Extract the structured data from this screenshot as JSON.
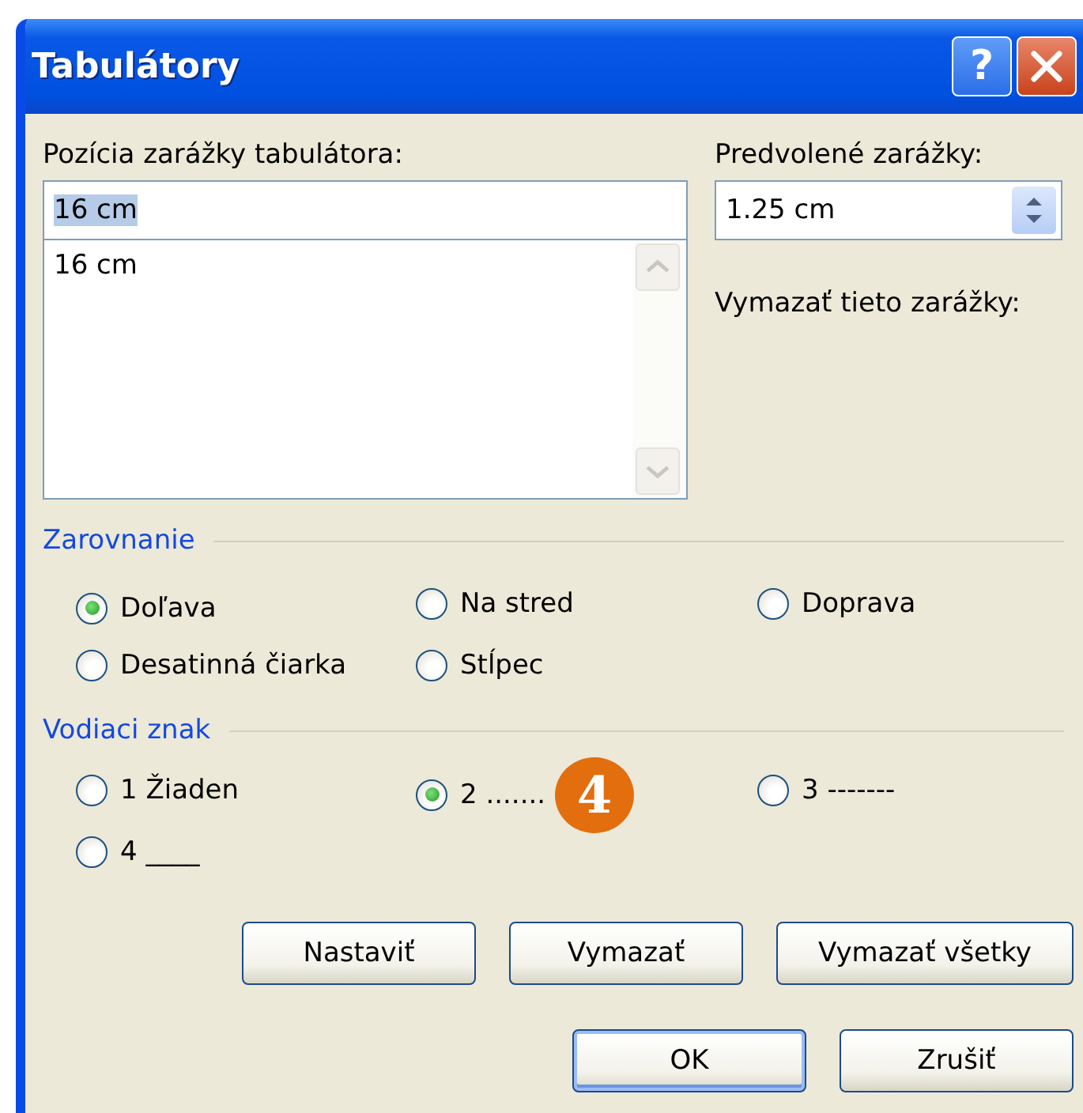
{
  "window": {
    "title": "Tabulátory",
    "help_button": "?"
  },
  "tab_stop_position": {
    "label": "Pozícia zarážky tabulátora:",
    "value": "16 cm",
    "value_selected": true,
    "list": [
      "16 cm"
    ]
  },
  "default_stops": {
    "label": "Predvolené zarážky:",
    "value": "1.25 cm"
  },
  "clear_label": "Vymazať tieto zarážky:",
  "alignment": {
    "title": "Zarovnanie",
    "options": [
      {
        "label": "Doľava",
        "selected": true
      },
      {
        "label": "Na stred",
        "selected": false
      },
      {
        "label": "Doprava",
        "selected": false
      },
      {
        "label": "Desatinná čiarka",
        "selected": false
      },
      {
        "label": "Stĺpec",
        "selected": false
      }
    ]
  },
  "leader": {
    "title": "Vodiaci znak",
    "options": [
      {
        "label": "1 Žiaden",
        "selected": false
      },
      {
        "label": "2 .......",
        "selected": true,
        "callout": "4"
      },
      {
        "label": "3 -------",
        "selected": false
      },
      {
        "label": "4 ____",
        "selected": false
      }
    ]
  },
  "tab_buttons": [
    {
      "label": "Nastaviť"
    },
    {
      "label": "Vymazať"
    },
    {
      "label": "Vymazať všetky"
    }
  ],
  "dialog_buttons": [
    {
      "label": "OK",
      "default": true
    },
    {
      "label": "Zrušiť",
      "default": false
    }
  ]
}
